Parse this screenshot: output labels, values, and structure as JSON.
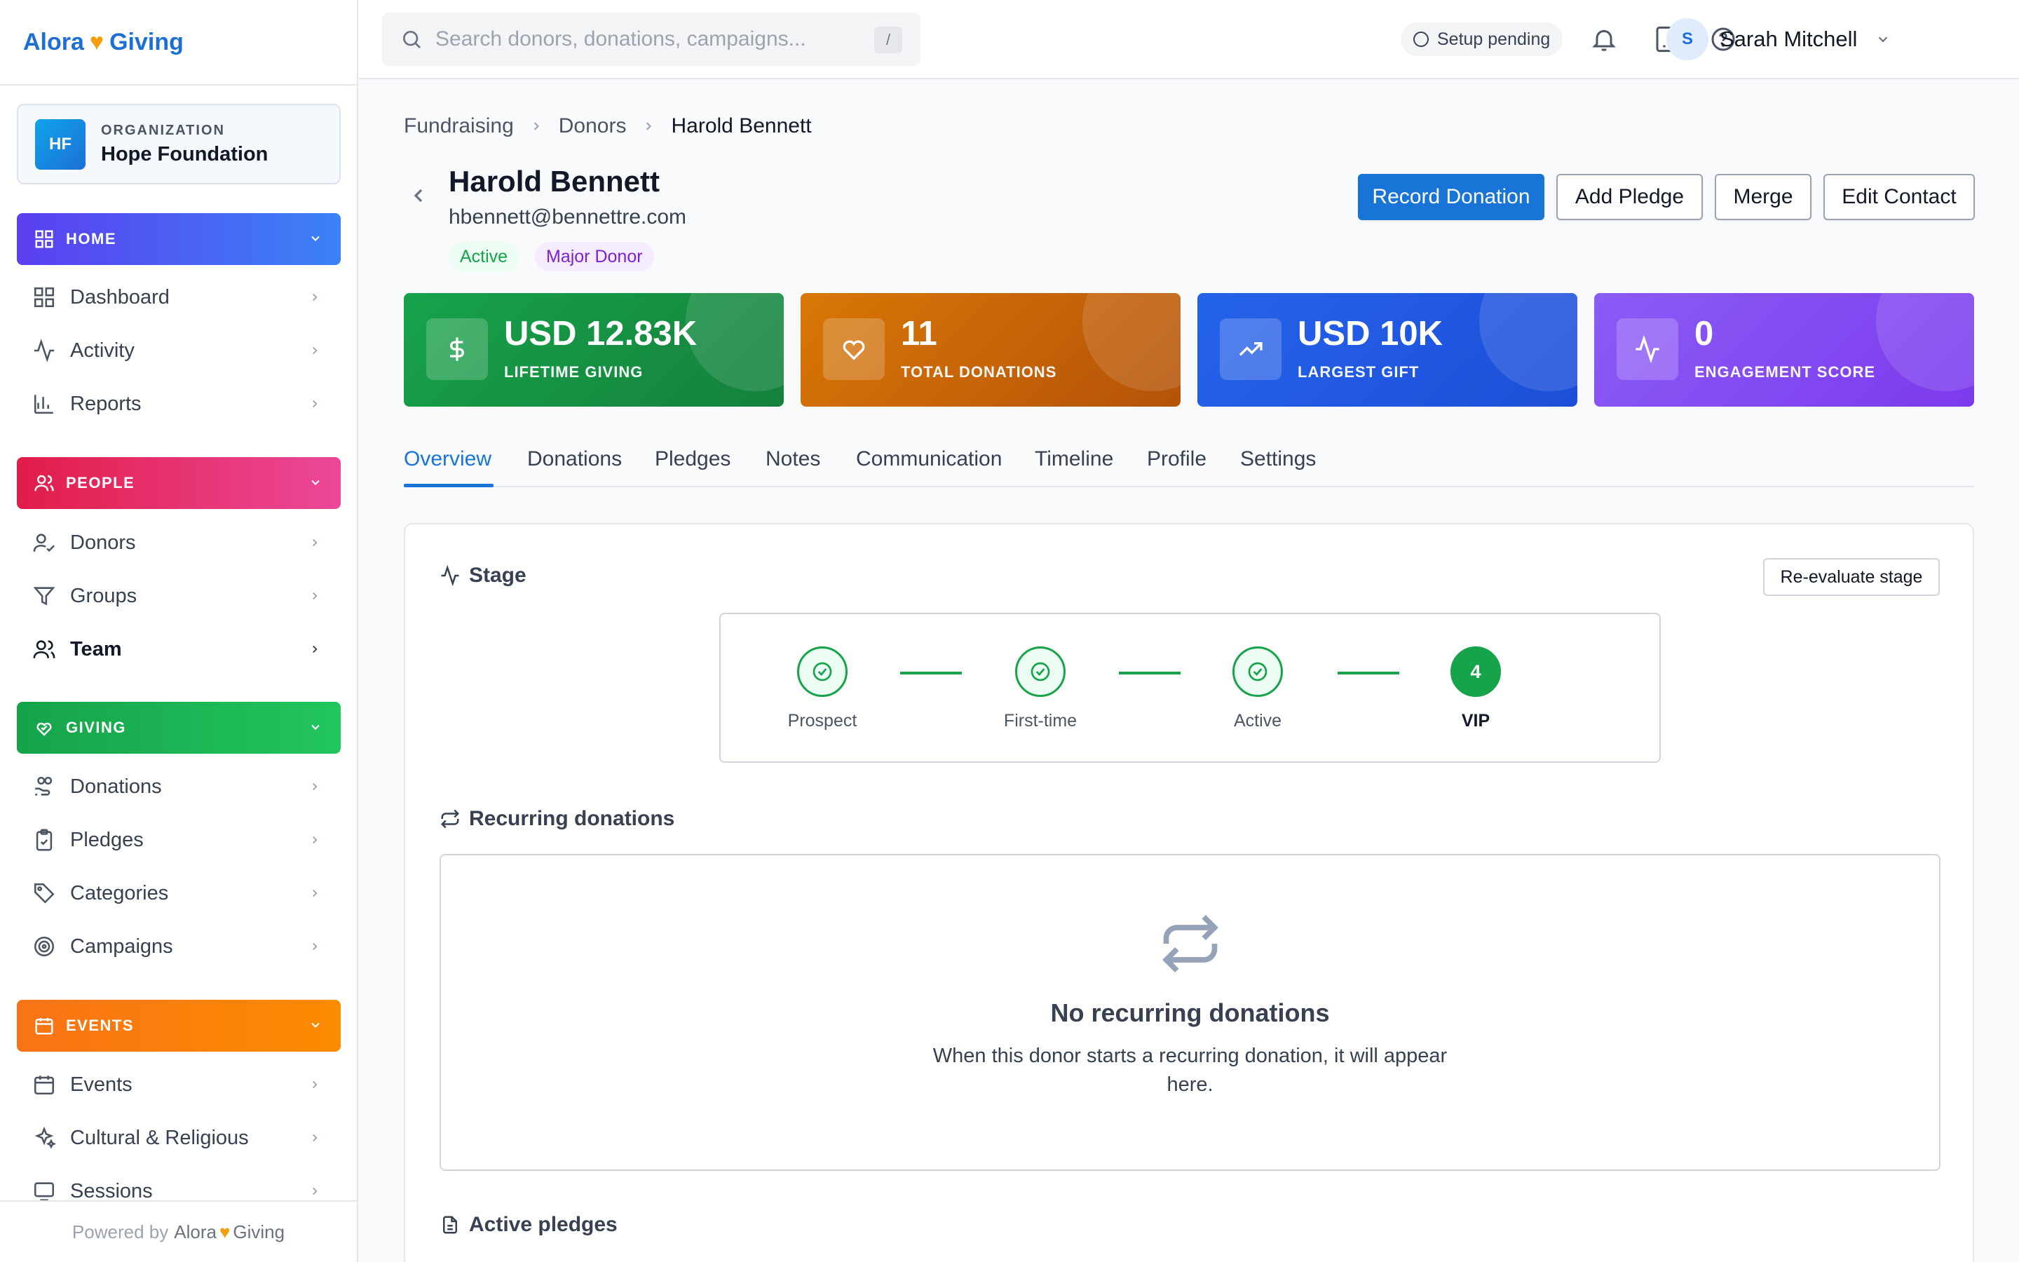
{
  "brand": {
    "name_left": "Alora",
    "name_right": "Giving"
  },
  "organization": {
    "label": "ORGANIZATION",
    "initials": "HF",
    "name": "Hope Foundation"
  },
  "sidebar": {
    "sections": [
      {
        "title": "HOME",
        "color": "#4f46e5",
        "items": [
          "Dashboard",
          "Activity",
          "Reports"
        ]
      },
      {
        "title": "PEOPLE",
        "color": "#e11d48",
        "items": [
          "Donors",
          "Groups",
          "Team"
        ]
      },
      {
        "title": "GIVING",
        "color": "#16a34a",
        "items": [
          "Donations",
          "Pledges",
          "Categories",
          "Campaigns"
        ]
      },
      {
        "title": "EVENTS",
        "color": "#f97316",
        "items": [
          "Events",
          "Cultural & Religious",
          "Sessions"
        ]
      }
    ],
    "active_item": "Team",
    "footer": {
      "prefix": "Powered by",
      "brand_left": "Alora",
      "brand_right": "Giving"
    }
  },
  "topbar": {
    "search_placeholder": "Search donors, donations, campaigns...",
    "search_shortcut": "/",
    "setup_status": "Setup pending",
    "user": {
      "initial": "S",
      "name": "Sarah Mitchell"
    }
  },
  "breadcrumb": [
    "Fundraising",
    "Donors",
    "Harold Bennett"
  ],
  "donor": {
    "name": "Harold Bennett",
    "email": "hbennett@bennettre.com",
    "tags": [
      "Active",
      "Major Donor"
    ]
  },
  "actions": {
    "record_donation": "Record Donation",
    "add_pledge": "Add Pledge",
    "merge": "Merge",
    "edit_contact": "Edit Contact"
  },
  "stats": [
    {
      "value": "USD 12.83K",
      "label": "LIFETIME GIVING",
      "icon": "dollar-icon"
    },
    {
      "value": "11",
      "label": "TOTAL DONATIONS",
      "icon": "heart-icon"
    },
    {
      "value": "USD 10K",
      "label": "LARGEST GIFT",
      "icon": "trending-up-icon"
    },
    {
      "value": "0",
      "label": "ENGAGEMENT SCORE",
      "icon": "activity-icon"
    }
  ],
  "tabs": [
    "Overview",
    "Donations",
    "Pledges",
    "Notes",
    "Communication",
    "Timeline",
    "Profile",
    "Settings"
  ],
  "active_tab": "Overview",
  "stage": {
    "title": "Stage",
    "reevaluate": "Re-evaluate stage",
    "steps": [
      "Prospect",
      "First-time",
      "Active",
      "VIP"
    ],
    "current_step_number": "4"
  },
  "recurring": {
    "title": "Recurring donations",
    "empty_title": "No recurring donations",
    "empty_desc": "When this donor starts a recurring donation, it will appear here."
  },
  "pledges": {
    "title": "Active pledges"
  },
  "colors": {
    "primary": "#1874d6",
    "success": "#16a34a"
  }
}
